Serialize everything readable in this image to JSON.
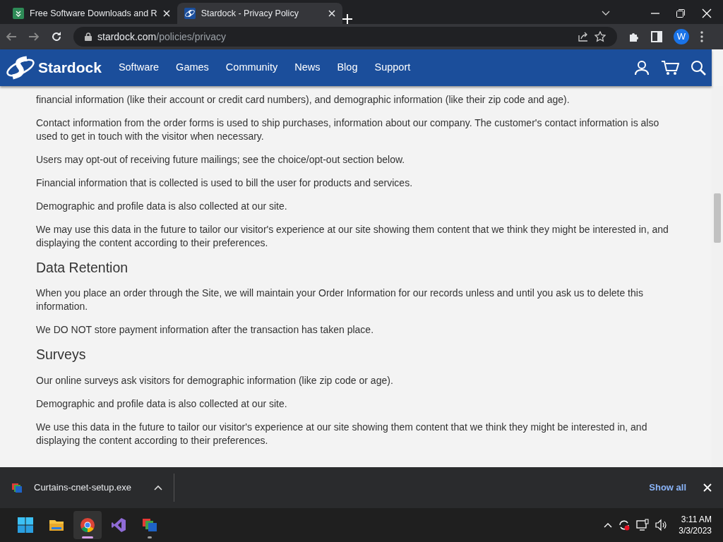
{
  "browser": {
    "tabs": [
      {
        "title": "Free Software Downloads and R",
        "selected": false,
        "kind": "download"
      },
      {
        "title": "Stardock - Privacy Policy",
        "selected": true,
        "kind": "stardock"
      }
    ],
    "url": {
      "host": "stardock.com",
      "path": "/policies/privacy"
    },
    "profile": "W"
  },
  "site_nav": {
    "brand": "Stardock",
    "items": [
      "Software",
      "Games",
      "Community",
      "News",
      "Blog",
      "Support"
    ]
  },
  "content": [
    {
      "kind": "p",
      "text": "financial information (like their account or credit card numbers), and demographic information (like their zip code and age)."
    },
    {
      "kind": "p",
      "text": "Contact information from the order forms is used to ship purchases, information about our company. The customer's contact information is also used to get in touch with the visitor when necessary."
    },
    {
      "kind": "p",
      "text": "Users may opt-out of receiving future mailings; see the choice/opt-out section below."
    },
    {
      "kind": "p",
      "text": "Financial information that is collected is used to bill the user for products and services."
    },
    {
      "kind": "p",
      "text": "Demographic and profile data is also collected at our site."
    },
    {
      "kind": "p",
      "text": "We may use this data in the future to tailor our visitor's experience at our site showing them content that we think they might be interested in, and displaying the content according to their preferences."
    },
    {
      "kind": "h",
      "text": "Data Retention"
    },
    {
      "kind": "p",
      "text": "When you place an order through the Site, we will maintain your Order Information for our records unless and until you ask us to delete this information."
    },
    {
      "kind": "p",
      "text": "We DO NOT store payment information after the transaction has taken place."
    },
    {
      "kind": "h",
      "text": "Surveys"
    },
    {
      "kind": "p",
      "text": "Our online surveys ask visitors for demographic information (like zip code or age)."
    },
    {
      "kind": "p",
      "text": "Demographic and profile data is also collected at our site."
    },
    {
      "kind": "p",
      "text": "We use this data in the future to tailor our visitor's experience at our site showing them content that we think they might be interested in, and displaying the content according to their preferences."
    }
  ],
  "download_bar": {
    "file": "Curtains-cnet-setup.exe",
    "show_all": "Show all"
  },
  "taskbar": {
    "apps": [
      {
        "kind": "files",
        "running": false,
        "selected": false
      },
      {
        "kind": "chrome",
        "running": true,
        "selected": true
      },
      {
        "kind": "studio",
        "running": false,
        "selected": false
      },
      {
        "kind": "installer",
        "running": true,
        "selected": false
      }
    ],
    "time": "3:11 AM",
    "date": "3/3/2023"
  }
}
